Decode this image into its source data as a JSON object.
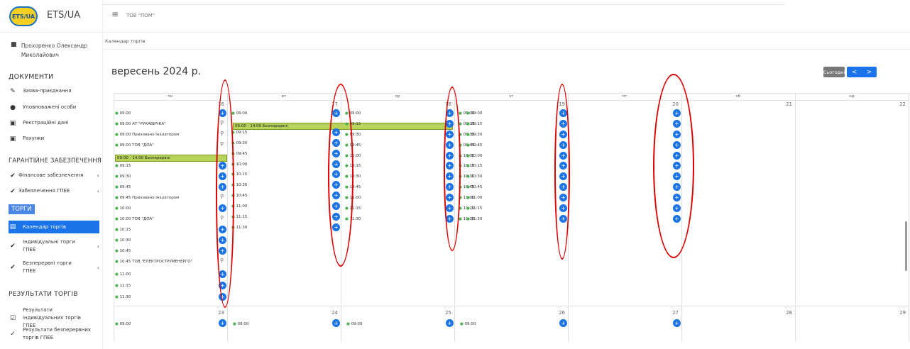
{
  "brand": {
    "name": "ETS/UA",
    "logo_text": "ETS/UA"
  },
  "user": {
    "name": "Прохоренко Олександр Миколайович"
  },
  "sidebar": {
    "documents_title": "ДОКУМЕНТИ",
    "doc_items": [
      {
        "label": "Заява-приєднання",
        "icon": "pen-icon"
      },
      {
        "label": "Уповноважені особи",
        "icon": "users-icon"
      },
      {
        "label": "Реєстраційні дані",
        "icon": "file-icon"
      },
      {
        "label": "Рахунки",
        "icon": "invoice-icon"
      }
    ],
    "guarantee_title": "ГАРАНТІЙНЕ ЗАБЕЗПЕЧЕННЯ",
    "guarantee_items": [
      {
        "label": "Фінансове забезпечення",
        "icon": "check-icon"
      },
      {
        "label": "Забезпечення ГПЕЕ",
        "icon": "check-icon"
      }
    ],
    "torgy_title": "ТОРГИ",
    "torgy_items": [
      {
        "label": "Календар торгів",
        "icon": "calendar-icon"
      },
      {
        "label": "Індивідуальні торги ГПЕЕ",
        "icon": "check-icon"
      },
      {
        "label": "Безперервні торги ГПЕЕ",
        "icon": "double-check-icon"
      }
    ],
    "results_title": "РЕЗУЛЬТАТИ ТОРГІВ",
    "results_items": [
      {
        "label": "Результати індивідуальних торгів ГПЕЕ",
        "icon": "checkbox-icon"
      },
      {
        "label": "Результати безперервних торгів ГПЕЕ",
        "icon": "check-circle-icon"
      }
    ]
  },
  "topbar": {
    "company": "ТОВ \"ПОМ\""
  },
  "breadcrumb": "Календар торгів",
  "calendar": {
    "title": "вересень 2024 р.",
    "today_label": "Сьогодні",
    "prev_label": "<",
    "next_label": ">",
    "weekdays": [
      "пн",
      "вт",
      "ср",
      "чт",
      "пт",
      "сб",
      "нд"
    ],
    "week1_days": [
      "16",
      "17",
      "18",
      "19",
      "20",
      "21",
      "22"
    ],
    "week2_days": [
      "23",
      "24",
      "25",
      "26",
      "27",
      "28",
      "29"
    ],
    "mon_events": [
      "09:00",
      "09:00 АТ \"РУКАВИЧКА\"",
      "09:00 Приховано Ініціатором",
      "09:00 ТОВ \"ДОА\"",
      "09:15",
      "09:30",
      "09:45",
      "09:45 Приховано Ініціатором",
      "10:00",
      "10:00 ТОВ \"ДОА\"",
      "10:15",
      "10:30",
      "10:45",
      "10:45 ТОВ \"ЕЛЕКТРОСТРУМЕНЕРГО\"",
      "11:00",
      "11:15",
      "11:30"
    ],
    "mon_banner": "09:00 - 14:00 Безперервні",
    "tue_banner": "09:00 - 14:00 Безперервні",
    "tue_events": [
      "09:00",
      "09:15",
      "09:30",
      "09:45",
      "10:00",
      "10:15",
      "10:30",
      "10:45",
      "11:00",
      "11:15",
      "11:30"
    ],
    "wed_events": [
      "09:00",
      "09:15",
      "09:30",
      "09:45",
      "10:00",
      "10:15",
      "10:30",
      "10:45",
      "11:00",
      "11:15",
      "11:30"
    ],
    "thu_events": [
      "09:00",
      "09:15",
      "09:30",
      "09:45",
      "10:00",
      "10:15",
      "10:30",
      "10:45",
      "11:00",
      "11:15",
      "11:30"
    ],
    "fri_events": [
      "09:00",
      "09:15",
      "09:30",
      "09:45",
      "10:00",
      "10:15",
      "10:30",
      "10:45",
      "11:00",
      "11:15",
      "11:30"
    ],
    "week2_events": [
      "09:00",
      "09:00",
      "09:00",
      "09:00"
    ]
  },
  "colors": {
    "accent": "#1a73e8",
    "banner": "#b7d35a",
    "annotation": "#d00000"
  }
}
